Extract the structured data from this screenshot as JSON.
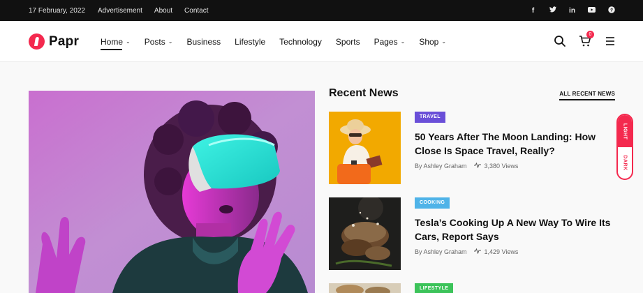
{
  "topbar": {
    "date": "17 February, 2022",
    "links": [
      "Advertisement",
      "About",
      "Contact"
    ],
    "socials": [
      "facebook-icon",
      "twitter-icon",
      "linkedin-icon",
      "youtube-icon",
      "pinterest-icon"
    ]
  },
  "header": {
    "brand": "Papr",
    "brand_color": "#f4294e",
    "nav": [
      {
        "label": "Home",
        "dropdown": true,
        "active": true
      },
      {
        "label": "Posts",
        "dropdown": true
      },
      {
        "label": "Business",
        "dropdown": false
      },
      {
        "label": "Lifestyle",
        "dropdown": false
      },
      {
        "label": "Technology",
        "dropdown": false
      },
      {
        "label": "Sports",
        "dropdown": false
      },
      {
        "label": "Pages",
        "dropdown": true
      },
      {
        "label": "Shop",
        "dropdown": true
      }
    ],
    "cart_count": "0"
  },
  "recent_news": {
    "title": "Recent News",
    "all_link": "ALL RECENT NEWS",
    "items": [
      {
        "category": "TRAVEL",
        "category_color": "#6a4fd8",
        "title": "50 Years After The Moon Landing: How Close Is Space Travel, Really?",
        "author": "By Ashley Graham",
        "views": "3,380 Views"
      },
      {
        "category": "COOKING",
        "category_color": "#4fb3e8",
        "title": "Tesla’s Cooking Up A New Way To Wire Its Cars, Report Says",
        "author": "By Ashley Graham",
        "views": "1,429 Views"
      },
      {
        "category": "LIFESTYLE",
        "category_color": "#3cc35a",
        "title": "",
        "author": "",
        "views": ""
      }
    ]
  },
  "mode_switch": {
    "light": "LIGHT",
    "dark": "DARK"
  }
}
